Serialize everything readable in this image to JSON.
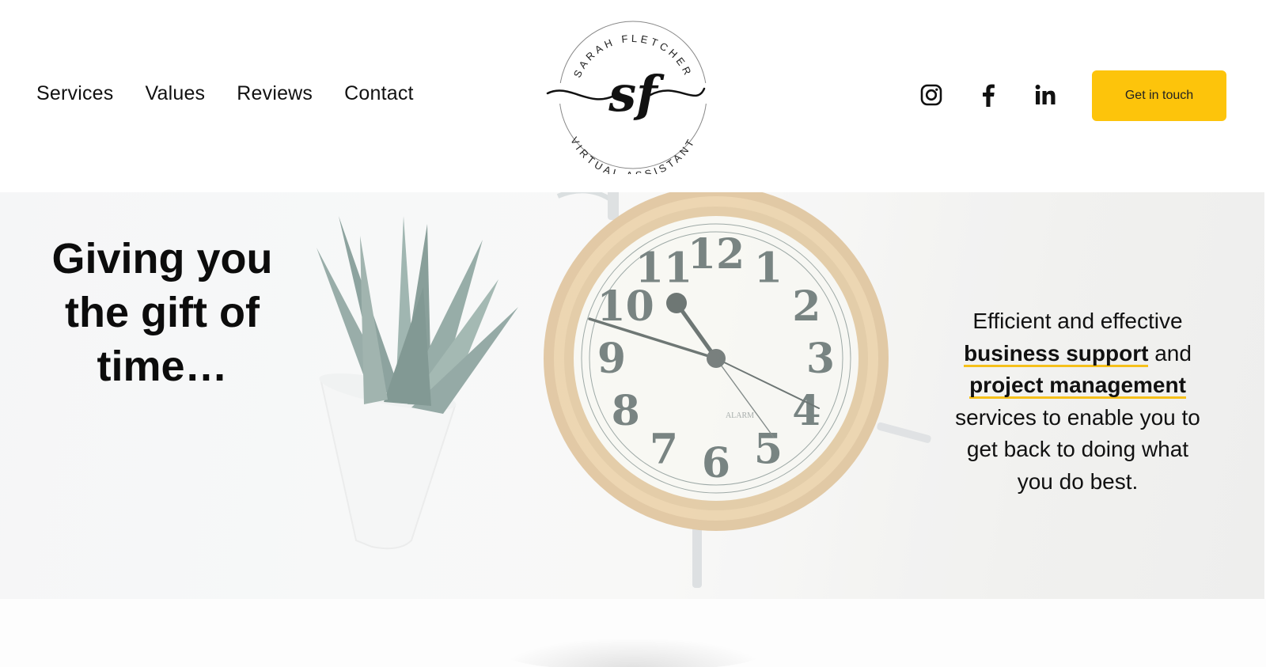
{
  "nav": {
    "items": [
      {
        "label": "Services"
      },
      {
        "label": "Values"
      },
      {
        "label": "Reviews"
      },
      {
        "label": "Contact"
      }
    ]
  },
  "logo": {
    "monogram": "sf",
    "top_text": "SARAH FLETCHER",
    "bottom_text": "VIRTUAL ASSISTANT"
  },
  "socials": [
    {
      "name": "instagram-icon"
    },
    {
      "name": "facebook-icon"
    },
    {
      "name": "linkedin-icon"
    }
  ],
  "cta": {
    "label": "Get in touch",
    "color": "#fdc40b"
  },
  "hero": {
    "heading_lines": [
      "Giving you",
      "the gift of",
      "time…"
    ],
    "tagline": {
      "line1": "Efficient and effective",
      "highlight1": "business support",
      "after1": " and",
      "highlight2": "project management",
      "rest_lines": [
        "services to enable you to",
        "get back to doing what",
        "you do best."
      ]
    },
    "highlight_color": "#f6c01a",
    "clock": {
      "numerals": [
        "12",
        "1",
        "2",
        "3",
        "4",
        "5",
        "6",
        "7",
        "8",
        "9",
        "10",
        "11"
      ],
      "dial_text": "ALARM"
    }
  }
}
